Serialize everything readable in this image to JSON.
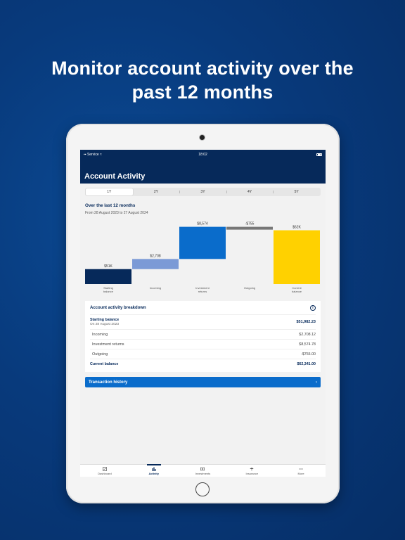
{
  "headline": {
    "line1": "Monitor account activity over the",
    "line2": "past 12 months"
  },
  "status": {
    "carrier": "Service",
    "time": "18:02"
  },
  "header": {
    "title": "Account Activity"
  },
  "periods": [
    {
      "label": "1Y",
      "active": true
    },
    {
      "label": "2Y",
      "active": false
    },
    {
      "label": "3Y",
      "active": false
    },
    {
      "label": "4Y",
      "active": false
    },
    {
      "label": "5Y",
      "active": false
    }
  ],
  "chart": {
    "title": "Over the last 12 months",
    "subtitle": "From 28 August 2023 to 27 August 2024"
  },
  "chart_data": {
    "type": "bar",
    "subtype": "waterfall",
    "categories": [
      "Starting balance",
      "Incoming",
      "Investment returns",
      "Outgoing",
      "Current balance"
    ],
    "values": [
      51982.23,
      2708.12,
      8574.78,
      -755.0,
      62341.0
    ],
    "data_labels": [
      "$51K",
      "$2,708",
      "$8,574",
      "-$755",
      "$62K"
    ],
    "colors": [
      "#06295a",
      "#7b9ad6",
      "#0a6ccb",
      "#777777",
      "#ffd100"
    ],
    "ylim": [
      48000,
      63000
    ],
    "grid": false,
    "legend": "none"
  },
  "breakdown": {
    "title": "Account activity breakdown",
    "start": {
      "label": "Starting balance",
      "date": "On 28 August 2023",
      "value": "$51,982.23"
    },
    "rows": [
      {
        "label": "Incoming",
        "value": "$2,708.12"
      },
      {
        "label": "Investment returns",
        "value": "$8,574.78"
      },
      {
        "label": "Outgoing",
        "value": "-$755.00"
      }
    ],
    "total": {
      "label": "Current balance",
      "value": "$62,341.00"
    }
  },
  "transaction": {
    "label": "Transaction history",
    "chevron": "›"
  },
  "tabs": [
    {
      "label": "Dashboard",
      "icon": "dashboard-icon",
      "active": false
    },
    {
      "label": "Activity",
      "icon": "activity-icon",
      "active": true
    },
    {
      "label": "Investments",
      "icon": "investments-icon",
      "active": false
    },
    {
      "label": "Insurance",
      "icon": "insurance-icon",
      "active": false
    },
    {
      "label": "More",
      "icon": "more-icon",
      "active": false
    }
  ]
}
